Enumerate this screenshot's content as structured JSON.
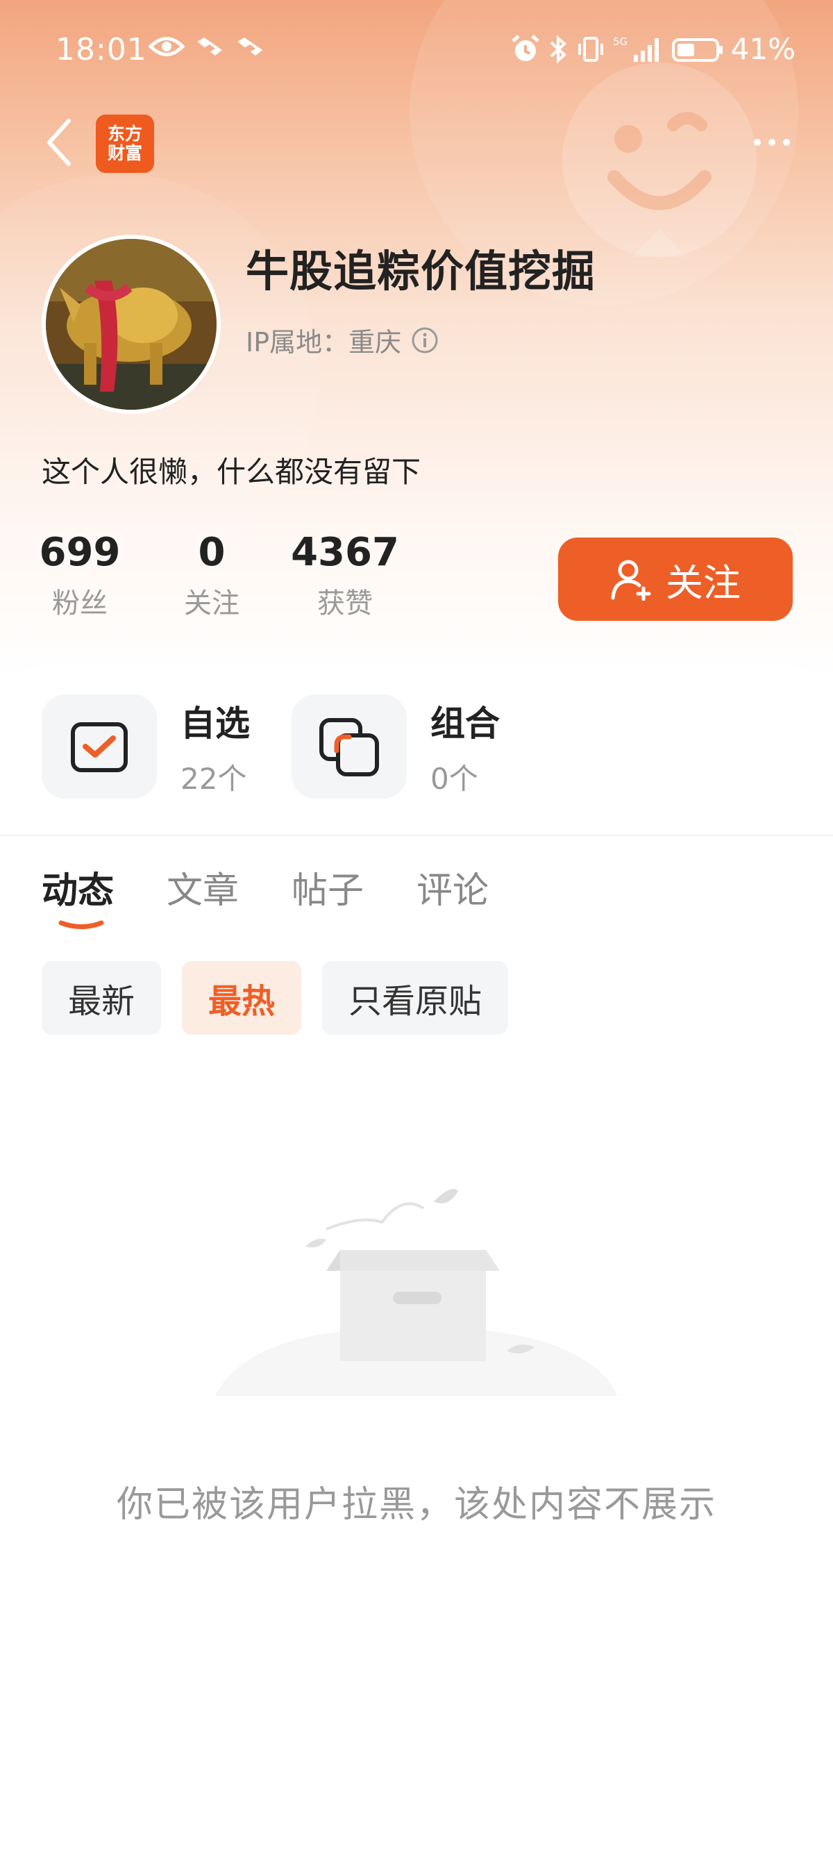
{
  "status_bar": {
    "time": "18:01",
    "battery": "41%",
    "network": "5G"
  },
  "brand": {
    "logo_line1": "东方",
    "logo_line2": "财富"
  },
  "profile": {
    "name": "牛股追粽价值挖掘",
    "ip_location": "IP属地：重庆",
    "bio": "这个人很懒，什么都没有留下"
  },
  "stats": {
    "fans": {
      "value": "699",
      "label": "粉丝"
    },
    "following": {
      "value": "0",
      "label": "关注"
    },
    "likes": {
      "value": "4367",
      "label": "获赞"
    }
  },
  "follow_button": {
    "label": "关注"
  },
  "quick": {
    "watchlist": {
      "title": "自选",
      "count": "22个"
    },
    "portfolio": {
      "title": "组合",
      "count": "0个"
    }
  },
  "tabs": [
    {
      "label": "动态",
      "active": true
    },
    {
      "label": "文章",
      "active": false
    },
    {
      "label": "帖子",
      "active": false
    },
    {
      "label": "评论",
      "active": false
    }
  ],
  "filters": [
    {
      "label": "最新",
      "active": false
    },
    {
      "label": "最热",
      "active": true
    },
    {
      "label": "只看原贴",
      "active": false
    }
  ],
  "empty_state": {
    "message": "你已被该用户拉黑，该处内容不展示"
  },
  "colors": {
    "accent": "#ee5f28",
    "header_top": "#f2a57e",
    "chip_bg": "#f4f5f7"
  }
}
